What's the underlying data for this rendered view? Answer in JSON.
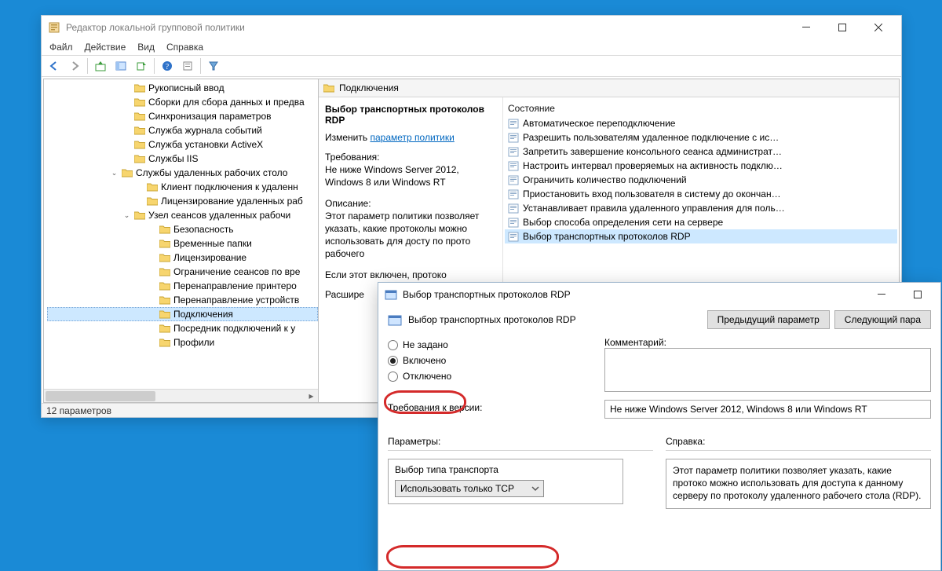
{
  "app": {
    "title": "Редактор локальной групповой политики",
    "menus": [
      "Файл",
      "Действие",
      "Вид",
      "Справка"
    ],
    "status": "12 параметров"
  },
  "tree": [
    {
      "indent": 96,
      "label": "Рукописный ввод"
    },
    {
      "indent": 96,
      "label": "Сборки для сбора данных и предва"
    },
    {
      "indent": 96,
      "label": "Синхронизация параметров"
    },
    {
      "indent": 96,
      "label": "Служба журнала событий"
    },
    {
      "indent": 96,
      "label": "Служба установки ActiveX"
    },
    {
      "indent": 96,
      "label": "Службы IIS"
    },
    {
      "indent": 80,
      "label": "Службы удаленных рабочих столо",
      "expander": "open"
    },
    {
      "indent": 112,
      "label": "Клиент подключения к удаленн"
    },
    {
      "indent": 112,
      "label": "Лицензирование удаленных раб"
    },
    {
      "indent": 96,
      "label": "Узел сеансов удаленных рабочи",
      "expander": "open"
    },
    {
      "indent": 128,
      "label": "Безопасность"
    },
    {
      "indent": 128,
      "label": "Временные папки"
    },
    {
      "indent": 128,
      "label": "Лицензирование"
    },
    {
      "indent": 128,
      "label": "Ограничение сеансов по вре"
    },
    {
      "indent": 128,
      "label": "Перенаправление принтеро"
    },
    {
      "indent": 128,
      "label": "Перенаправление устройств"
    },
    {
      "indent": 128,
      "label": "Подключения",
      "selected": true
    },
    {
      "indent": 128,
      "label": "Посредник подключений к у"
    },
    {
      "indent": 128,
      "label": "Профили"
    }
  ],
  "path_header": "Подключения",
  "detail": {
    "heading": "Выбор транспортных протоколов RDP",
    "edit_label": "Изменить",
    "edit_link": "параметр политики",
    "req_label": "Требования:",
    "req_text": "Не ниже Windows Server 2012, Windows 8 или Windows RT",
    "desc_label": "Описание:",
    "desc_text": "Этот параметр политики позволяет указать, какие протоколы можно использовать для досту по прото рабочего",
    "desc_tail": "Если этот включен, протоко",
    "expand_label": "Расшире"
  },
  "settings_state_label": "Состояние",
  "settings": [
    "Автоматическое переподключение",
    "Разрешить пользователям удаленное подключение с ис…",
    "Запретить завершение консольного сеанса администрат…",
    "Настроить интервал проверяемых на активность подклю…",
    "Ограничить количество подключений",
    "Приостановить вход пользователя в систему до окончан…",
    "Устанавливает правила удаленного управления для поль…",
    "Выбор способа определения сети на сервере",
    "Выбор транспортных протоколов RDP"
  ],
  "settings_selected_index": 8,
  "dialog": {
    "title": "Выбор транспортных протоколов RDP",
    "subtitle": "Выбор транспортных протоколов RDP",
    "prev_btn": "Предыдущий параметр",
    "next_btn": "Следующий пара",
    "radio_notset": "Не задано",
    "radio_on": "Включено",
    "radio_off": "Отключено",
    "comment_label": "Комментарий:",
    "req_label": "Требования к версии:",
    "req_value": "Не ниже Windows Server 2012, Windows 8 или Windows RT",
    "params_label": "Параметры:",
    "help_label": "Справка:",
    "param_title": "Выбор типа транспорта",
    "combo_value": "Использовать только TCP",
    "help_text": "Этот параметр политики позволяет указать, какие протоко можно использовать для доступа к данному серверу по протоколу удаленного рабочего стола (RDP)."
  }
}
